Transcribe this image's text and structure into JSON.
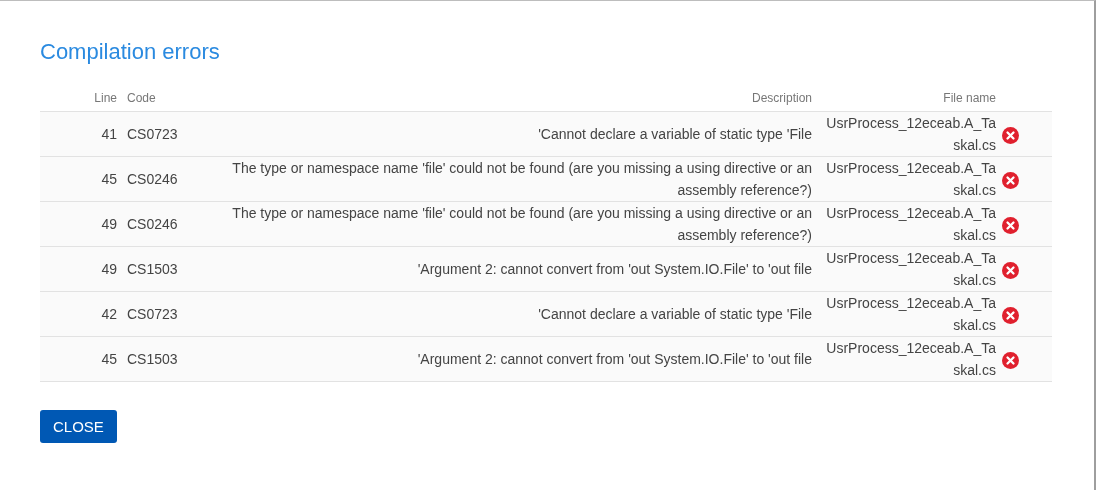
{
  "dialog": {
    "title": "Compilation errors"
  },
  "table": {
    "columns": [
      "Line",
      "Code",
      "Description",
      "File name"
    ],
    "rows": [
      {
        "line": "41",
        "code": "CS0723",
        "description": "'Cannot declare a variable of static type 'File",
        "file_name": "UsrProcess_12eceab.A_Taskal.cs",
        "kind": "error"
      },
      {
        "line": "45",
        "code": "CS0246",
        "description": "The type or namespace name 'file' could not be found (are you missing a using directive or an assembly reference?)",
        "file_name": "UsrProcess_12eceab.A_Taskal.cs",
        "kind": "error"
      },
      {
        "line": "49",
        "code": "CS0246",
        "description": "The type or namespace name 'file' could not be found (are you missing a using directive or an assembly reference?)",
        "file_name": "UsrProcess_12eceab.A_Taskal.cs",
        "kind": "error"
      },
      {
        "line": "49",
        "code": "CS1503",
        "description": "'Argument 2: cannot convert from 'out System.IO.File' to 'out file",
        "file_name": "UsrProcess_12eceab.A_Taskal.cs",
        "kind": "error"
      },
      {
        "line": "42",
        "code": "CS0723",
        "description": "'Cannot declare a variable of static type 'File",
        "file_name": "UsrProcess_12eceab.A_Taskal.cs",
        "kind": "error"
      },
      {
        "line": "45",
        "code": "CS1503",
        "description": "'Argument 2: cannot convert from 'out System.IO.File' to 'out file",
        "file_name": "UsrProcess_12eceab.A_Taskal.cs",
        "kind": "error"
      }
    ]
  },
  "buttons": [
    {
      "label": "CLOSE"
    }
  ]
}
